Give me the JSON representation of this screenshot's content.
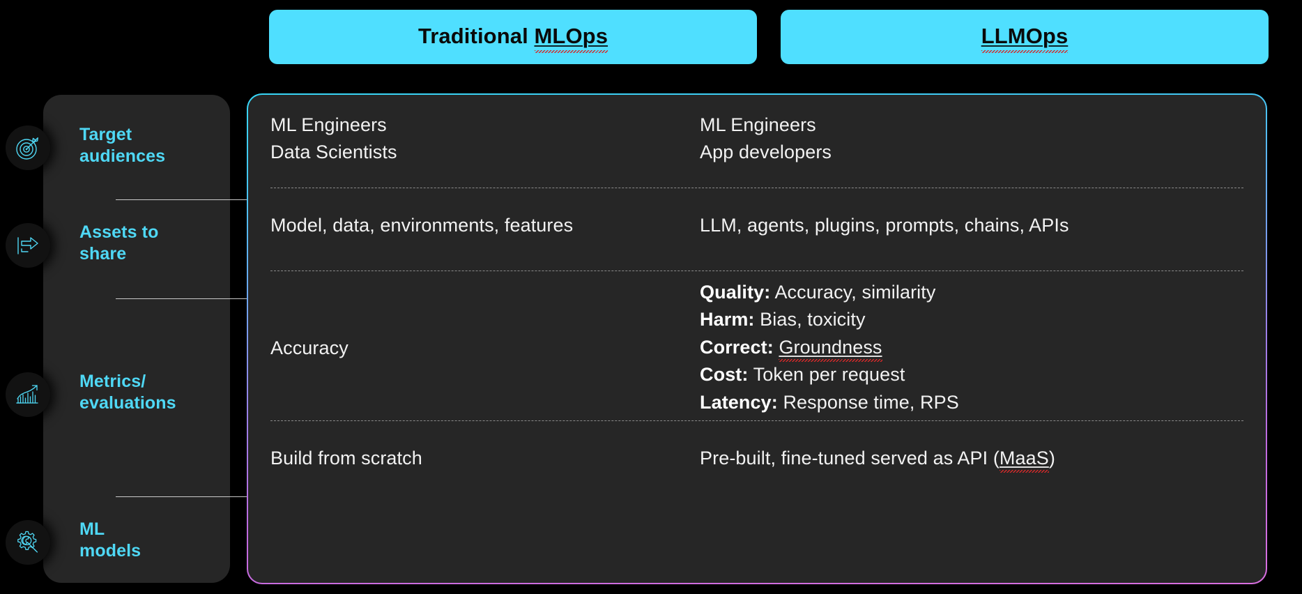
{
  "columns": [
    {
      "id": "traditional-mlops",
      "label": "Traditional MLOps",
      "squiggle_part": "MLOps",
      "prefix": "Traditional "
    },
    {
      "id": "llmops",
      "label": "LLMOps",
      "squiggle_part": "LLMOps",
      "prefix": ""
    }
  ],
  "categories": [
    {
      "id": "target-audiences",
      "label": "Target audiences",
      "icon": "target-icon"
    },
    {
      "id": "assets-to-share",
      "label": "Assets to share",
      "icon": "share-icon"
    },
    {
      "id": "metrics-evaluations",
      "label": "Metrics/ evaluations",
      "icon": "bar-chart-trend-icon"
    },
    {
      "id": "ml-models",
      "label": "ML models",
      "icon": "gear-wrench-icon"
    }
  ],
  "rows": [
    {
      "id": "target-audiences",
      "left_lines": [
        "ML Engineers",
        "Data Scientists"
      ],
      "right_lines": [
        "ML Engineers",
        "App developers"
      ]
    },
    {
      "id": "assets-to-share",
      "left_lines": [
        "Model, data, environments, features"
      ],
      "right_lines": [
        "LLM, agents, plugins, prompts, chains, APIs"
      ]
    },
    {
      "id": "metrics-evaluations",
      "left_lines": [
        "Accuracy"
      ],
      "right_items": [
        {
          "label": "Quality:",
          "value": "Accuracy, similarity"
        },
        {
          "label": "Harm:",
          "value": "Bias, toxicity"
        },
        {
          "label": "Correct:",
          "value": "Groundness",
          "value_squiggle": true
        },
        {
          "label": "Cost:",
          "value": "Token per request"
        },
        {
          "label": "Latency:",
          "value": "Response time, RPS"
        }
      ]
    },
    {
      "id": "ml-models",
      "left_lines": [
        "Build from scratch"
      ],
      "right_lines": [
        "Pre-built, fine-tuned served as API (MaaS)"
      ],
      "right_squiggle_word": "MaaS"
    }
  ],
  "colors": {
    "background": "#000000",
    "panel": "#262626",
    "accent_cyan": "#4FD8F5",
    "header_pill": "#4FDFFF",
    "border_gradient_start": "#38d7f7",
    "border_gradient_end": "#d96fe0",
    "text": "#f2f2f2",
    "divider": "#8a8a8a",
    "spell_error": "#d42a2a"
  }
}
